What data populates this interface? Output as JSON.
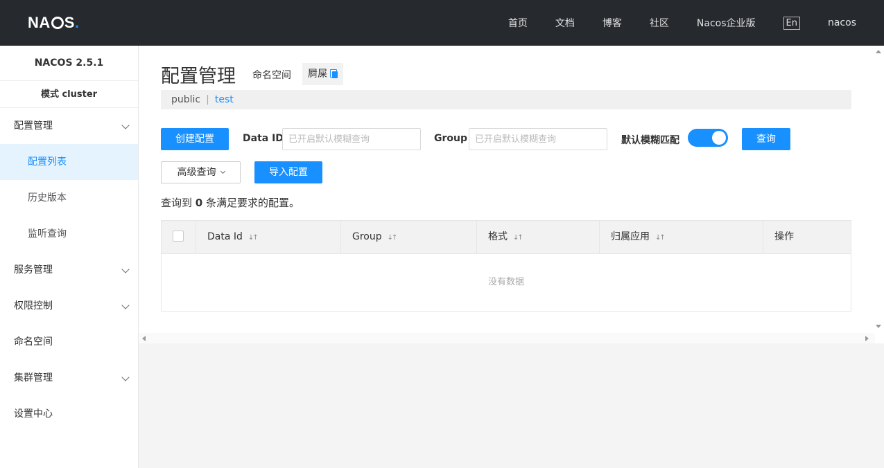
{
  "header": {
    "logo": "NACOS.",
    "nav": [
      "首页",
      "文档",
      "博客",
      "社区",
      "Nacos企业版"
    ],
    "lang": "En",
    "user": "nacos"
  },
  "sidebar": {
    "version": "NACOS 2.5.1",
    "mode": "模式 cluster",
    "items": [
      {
        "label": "配置管理",
        "expandable": true
      },
      {
        "label": "配置列表",
        "sub": true,
        "active": true
      },
      {
        "label": "历史版本",
        "sub": true
      },
      {
        "label": "监听查询",
        "sub": true
      },
      {
        "label": "服务管理",
        "expandable": true
      },
      {
        "label": "权限控制",
        "expandable": true
      },
      {
        "label": "命名空间"
      },
      {
        "label": "集群管理",
        "expandable": true
      },
      {
        "label": "设置中心"
      }
    ]
  },
  "main": {
    "title": "配置管理",
    "namespace_label": "命名空间",
    "namespace_value": "屙屎",
    "namespaces": [
      "public",
      "test"
    ],
    "active_namespace": "test",
    "toolbar": {
      "create_button": "创建配置",
      "dataid_label": "Data ID",
      "dataid_placeholder": "已开启默认模糊查询",
      "group_label": "Group",
      "group_placeholder": "已开启默认模糊查询",
      "fuzzy_label": "默认模糊匹配",
      "fuzzy_on": true,
      "search_button": "查询",
      "advanced_button": "高级查询",
      "import_button": "导入配置"
    },
    "result": {
      "prefix": "查询到",
      "count": "0",
      "suffix": "条满足要求的配置。"
    },
    "table": {
      "columns": [
        "Data Id",
        "Group",
        "格式",
        "归属应用",
        "操作"
      ],
      "empty_text": "没有数据"
    }
  },
  "colors": {
    "primary": "#1890ff",
    "header_bg": "#262a2e",
    "active_bg": "#e5f3ff"
  }
}
